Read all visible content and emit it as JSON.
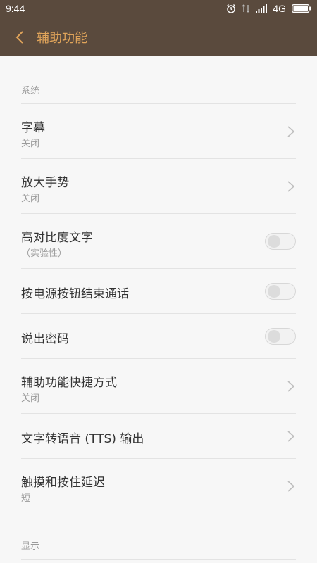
{
  "status_bar": {
    "time": "9:44",
    "network": "4G"
  },
  "header": {
    "title": "辅助功能"
  },
  "sections": {
    "system": "系统",
    "display": "显示"
  },
  "items": [
    {
      "title": "字幕",
      "subtitle": "关闭",
      "control": "chevron"
    },
    {
      "title": "放大手势",
      "subtitle": "关闭",
      "control": "chevron"
    },
    {
      "title": "高对比度文字",
      "subtitle": "（实验性）",
      "control": "toggle",
      "state": "off"
    },
    {
      "title": "按电源按钮结束通话",
      "control": "toggle",
      "state": "off"
    },
    {
      "title": "说出密码",
      "control": "toggle",
      "state": "off"
    },
    {
      "title": "辅助功能快捷方式",
      "subtitle": "关闭",
      "control": "chevron"
    },
    {
      "title": "文字转语音 (TTS) 输出",
      "control": "chevron"
    },
    {
      "title": "触摸和按住延迟",
      "subtitle": "短",
      "control": "chevron"
    }
  ],
  "colors": {
    "header_bg": "#5a4a3d",
    "accent": "#e0a45a"
  }
}
